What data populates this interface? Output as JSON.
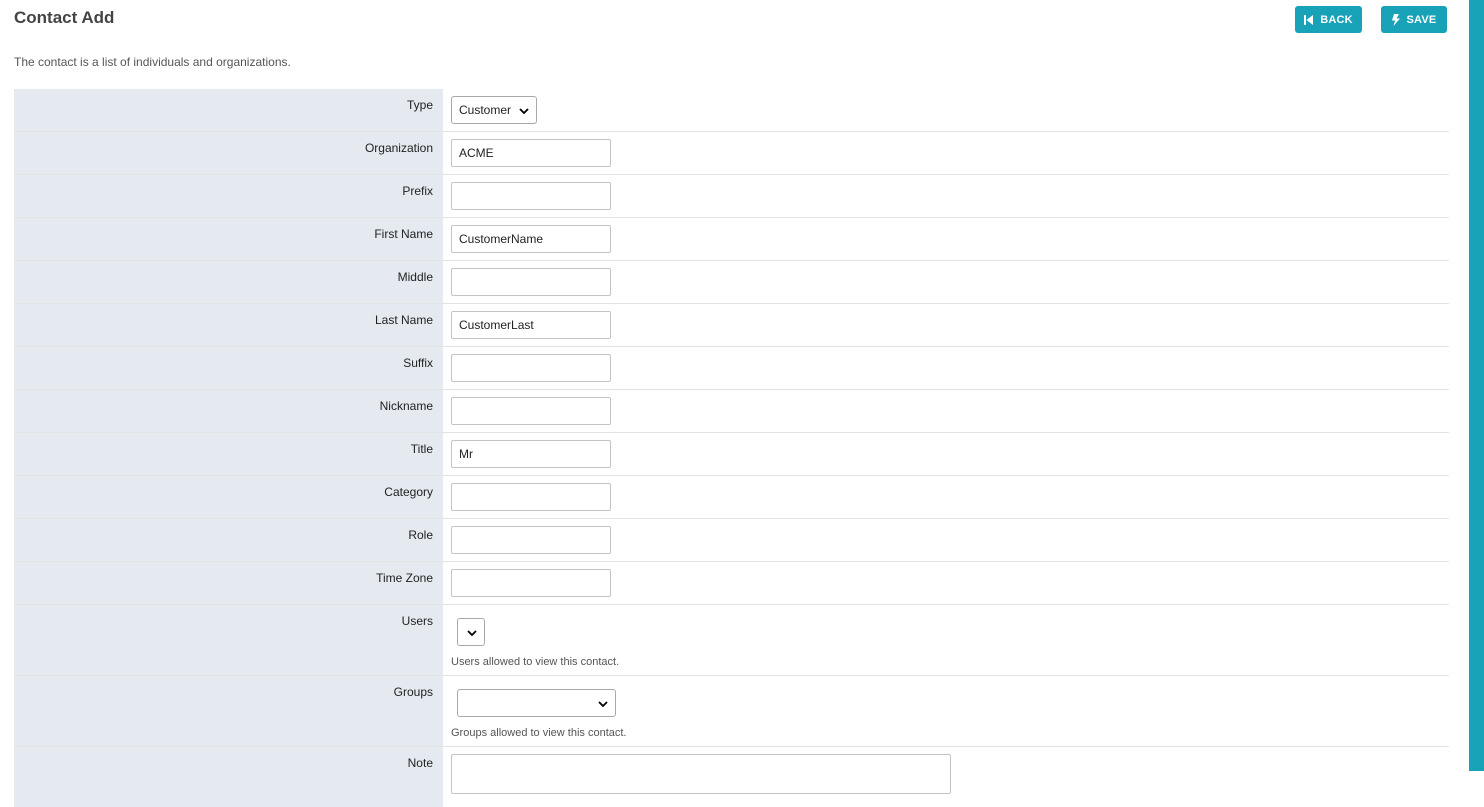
{
  "header": {
    "title": "Contact Add",
    "description": "The contact is a list of individuals and organizations.",
    "back_label": "BACK",
    "save_label": "SAVE",
    "back_icon": "skip-back-icon",
    "save_icon": "bolt-icon",
    "accent_color": "#17a2b8"
  },
  "form": {
    "type": {
      "label": "Type",
      "value": "Customer"
    },
    "organization": {
      "label": "Organization",
      "value": "ACME"
    },
    "prefix": {
      "label": "Prefix",
      "value": ""
    },
    "first_name": {
      "label": "First Name",
      "value": "CustomerName"
    },
    "middle": {
      "label": "Middle",
      "value": ""
    },
    "last_name": {
      "label": "Last Name",
      "value": "CustomerLast"
    },
    "suffix": {
      "label": "Suffix",
      "value": ""
    },
    "nickname": {
      "label": "Nickname",
      "value": ""
    },
    "title": {
      "label": "Title",
      "value": "Mr"
    },
    "category": {
      "label": "Category",
      "value": ""
    },
    "role": {
      "label": "Role",
      "value": ""
    },
    "time_zone": {
      "label": "Time Zone",
      "value": ""
    },
    "users": {
      "label": "Users",
      "value": "",
      "help": "Users allowed to view this contact."
    },
    "groups": {
      "label": "Groups",
      "value": "",
      "help": "Groups allowed to view this contact."
    },
    "note": {
      "label": "Note",
      "value": ""
    }
  }
}
